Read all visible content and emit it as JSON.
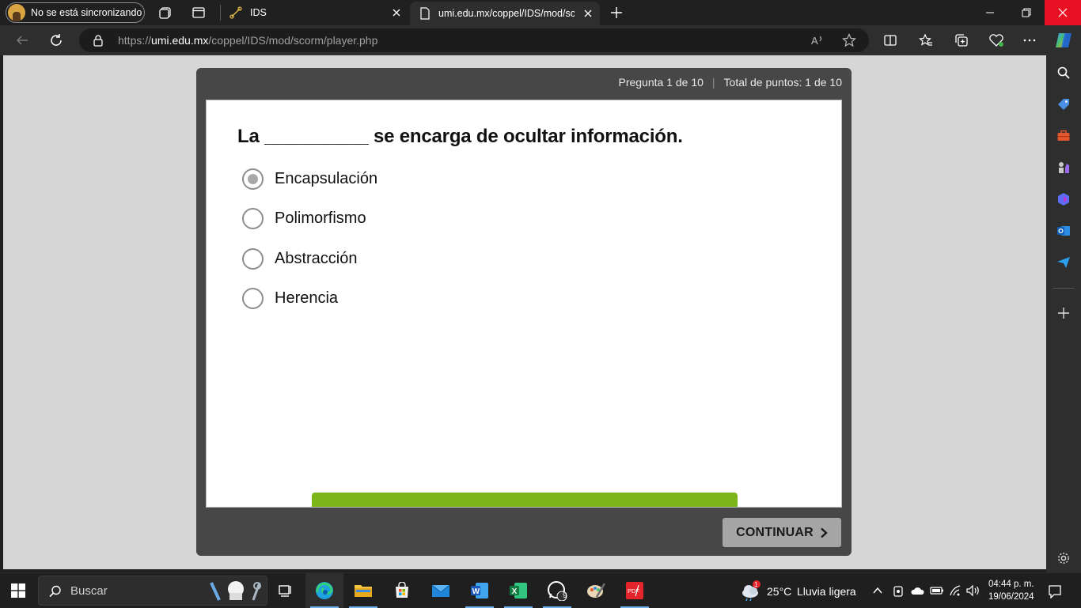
{
  "browser": {
    "profile_label": "No se está sincronizando",
    "tabs": [
      {
        "title": "IDS",
        "active": false
      },
      {
        "title": "umi.edu.mx/coppel/IDS/mod/scorm/player.php",
        "active": true
      }
    ],
    "address": {
      "scheme": "https://",
      "domain": "umi.edu.mx",
      "path": "/coppel/IDS/mod/scorm/player.php"
    },
    "sidebar_icons": [
      "search-icon",
      "tag-icon",
      "toolbox-icon",
      "chess-icon",
      "copilot-icon",
      "outlook-icon",
      "send-icon",
      "add-icon",
      "settings-icon"
    ]
  },
  "quiz": {
    "status_question": "Pregunta 1 de 10",
    "status_points": "Total de puntos: 1 de 10",
    "question": "La __________ se encarga de ocultar información.",
    "options": [
      {
        "label": "Encapsulación",
        "selected": true
      },
      {
        "label": "Polimorfismo",
        "selected": false
      },
      {
        "label": "Abstracción",
        "selected": false
      },
      {
        "label": "Herencia",
        "selected": false
      }
    ],
    "continue_label": "CONTINUAR",
    "accent_color": "#7cb518"
  },
  "taskbar": {
    "search_placeholder": "Buscar",
    "whatsapp_badge": "9",
    "weather_badge": "1",
    "weather": "25°C",
    "weather_desc": "Lluvia ligera",
    "time": "04:44 p. m.",
    "date": "19/06/2024"
  }
}
